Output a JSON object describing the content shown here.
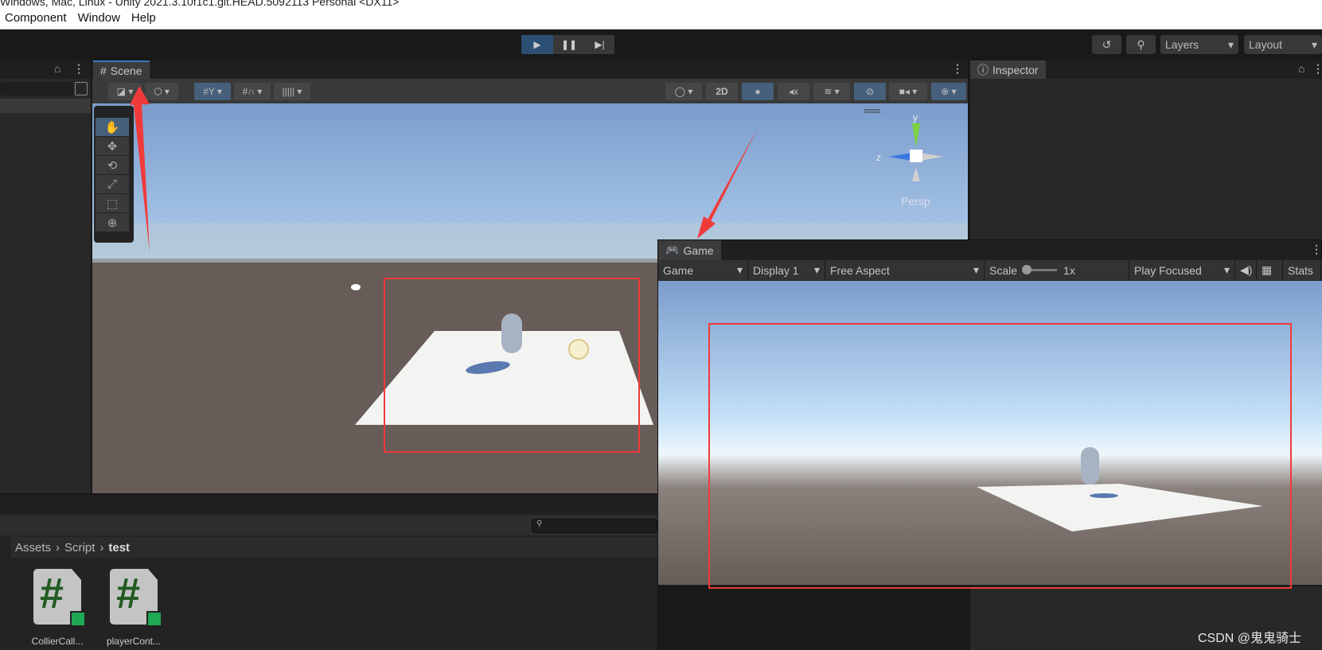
{
  "window": {
    "title": "Windows, Mac, Linux - Unity 2021.3.10f1c1.git.HEAD.5092113 Personal <DX11>"
  },
  "menu": [
    "Component",
    "Window",
    "Help"
  ],
  "toolbar": {
    "play_icon": "play-icon",
    "pause_icon": "pause-icon",
    "step_icon": "step-icon",
    "layers": "Layers",
    "layout": "Layout",
    "accent": "#2c4f74"
  },
  "scene": {
    "tab": "Scene",
    "mode_2d": "2D",
    "view_label": "Persp",
    "gizmo": {
      "y": "y",
      "z": "z"
    }
  },
  "inspector": {
    "tab": "Inspector"
  },
  "game": {
    "tab": "Game",
    "view_select": "Game",
    "display": "Display 1",
    "aspect": "Free Aspect",
    "scale_label": "Scale",
    "scale_value": "1x",
    "play_mode": "Play Focused",
    "stats": "Stats"
  },
  "project": {
    "breadcrumb": [
      "Assets",
      "Script",
      "test"
    ],
    "assets": [
      {
        "name": "CollierCall..."
      },
      {
        "name": "playerCont..."
      }
    ]
  },
  "annotations": {
    "color": "#f03a3a"
  },
  "watermark": "CSDN @鬼鬼骑士"
}
